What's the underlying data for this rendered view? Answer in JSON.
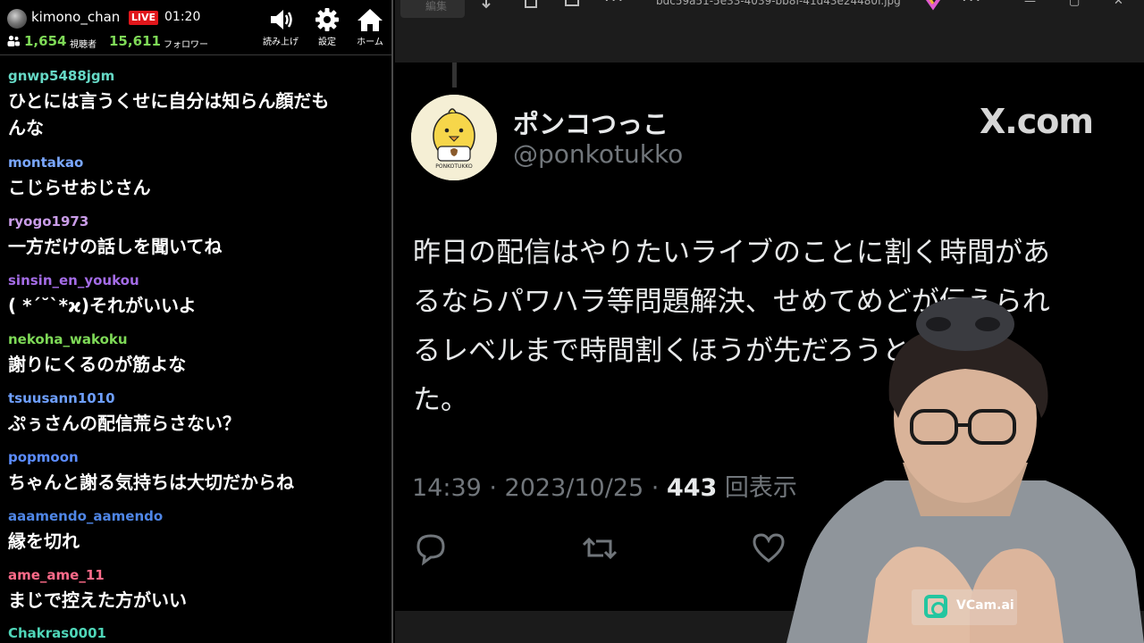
{
  "chat": {
    "username": "kimono_chan",
    "live_label": "LIVE",
    "elapsed": "01:20",
    "viewers": "1,654",
    "viewers_label": "視聴者",
    "followers": "15,611",
    "followers_label": "フォロワー",
    "buttons": {
      "readout": "読み上げ",
      "settings": "設定",
      "home": "ホーム"
    },
    "messages": [
      {
        "user": "gnwp5488jgm",
        "color": "#66d9c6",
        "text": [
          "ひとには言うくせに自分は知らん顔だも",
          "んな"
        ]
      },
      {
        "user": "montakao",
        "color": "#7aa7ff",
        "text": [
          "こじらせおじさん"
        ]
      },
      {
        "user": "ryogo1973",
        "color": "#c99ce8",
        "text": [
          "一方だけの話しを聞いてね"
        ]
      },
      {
        "user": "sinsin_en_youkou",
        "color": "#a46ce6",
        "text": [
          "( *´˘`*ϰ)それがいいよ"
        ]
      },
      {
        "user": "nekoha_wakoku",
        "color": "#7ed957",
        "text": [
          "謝りにくるのが筋よな"
        ]
      },
      {
        "user": "tsuusann1010",
        "color": "#6e9fff",
        "text": [
          "ぷぅさんの配信荒らさない？"
        ]
      },
      {
        "user": "popmoon",
        "color": "#5b8cff",
        "text": [
          "ちゃんと謝る気持ちは大切だからね"
        ]
      },
      {
        "user": "aaamendo_aamendo",
        "color": "#4f86e6",
        "text": [
          "縁を切れ"
        ]
      },
      {
        "user": "ame_ame_11",
        "color": "#ff6b8a",
        "text": [
          "まじで控えた方がいい"
        ]
      },
      {
        "user": "Chakras0001",
        "color": "#4fd6b8",
        "text": []
      }
    ]
  },
  "viewer": {
    "toolbar": {
      "edit_label": "編集",
      "filename": "bdc59a51-5e33-4039-bb8f-41d43e24480f.jpg"
    },
    "tweet": {
      "display_name": "ポンコつっこ",
      "handle": "@ponkotukko",
      "brand": "X.com",
      "avatar_caption": "PONKOTUKKO",
      "body_lines": [
        "昨日の配信はやりたいライブのことに割く時間があ",
        "るならパワハラ等問題解決、せめてめどが伝えられ",
        "るレベルまで時間割くほうが先だろうと思いまし",
        "た。"
      ],
      "time": "14:39 · 2023/10/25 · ",
      "views_count": "443",
      "views_label": " 回表示"
    },
    "overlay": {
      "vcam_label": "VCam.ai"
    }
  },
  "colors": {
    "live_red": "#e0161b",
    "count_green": "#7ed957",
    "tweet_gray": "#71767b"
  }
}
